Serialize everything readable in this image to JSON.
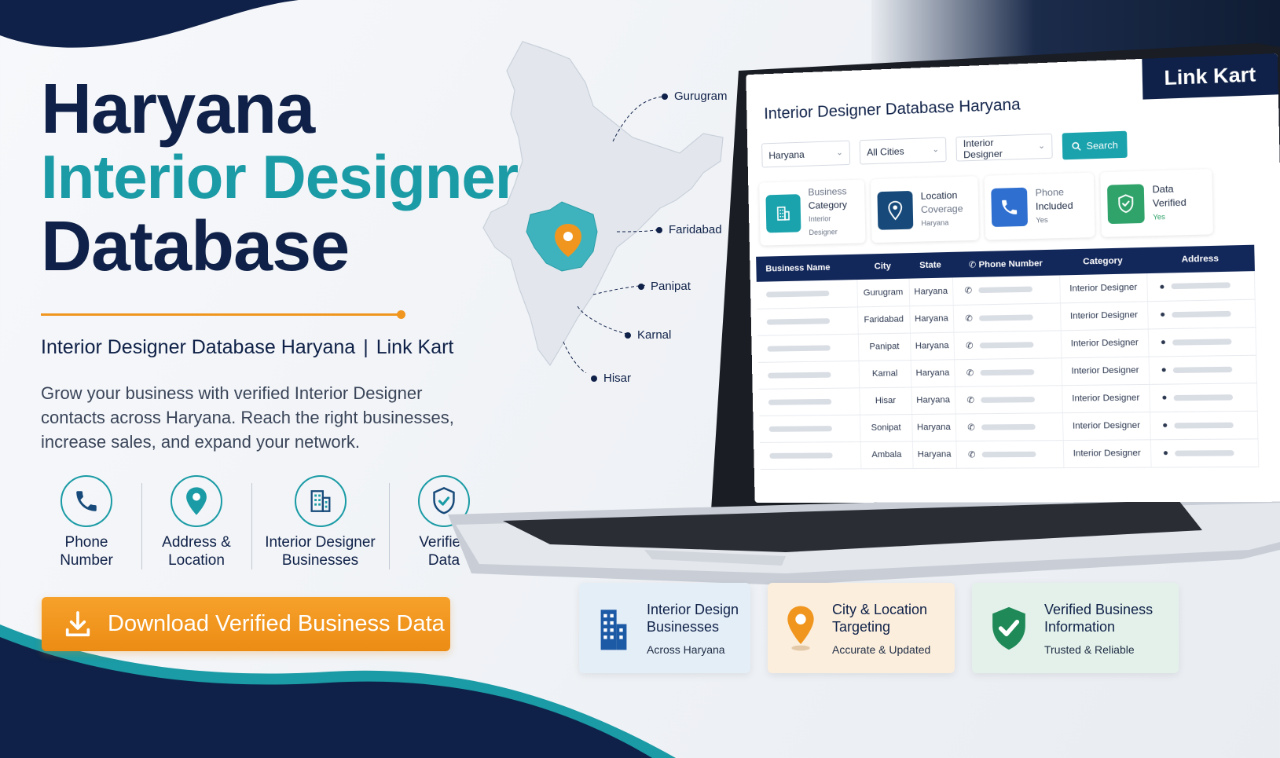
{
  "brand": "Link Kart",
  "hero": {
    "line1": "Haryana",
    "line2": "Interior Designer",
    "line3": "Database",
    "subtitle_left": "Interior Designer Database Haryana",
    "subtitle_sep": "|",
    "subtitle_right": "Link Kart",
    "description": "Grow your business with verified Interior Designer contacts across Haryana. Reach the right businesses, increase sales, and expand your network."
  },
  "features": [
    {
      "icon": "phone-icon",
      "label_1": "Phone",
      "label_2": "Number"
    },
    {
      "icon": "location-pin-icon",
      "label_1": "Address &",
      "label_2": "Location"
    },
    {
      "icon": "building-icon",
      "label_1": "Interior Designer",
      "label_2": "Businesses"
    },
    {
      "icon": "shield-check-icon",
      "label_1": "Verified",
      "label_2": "Data"
    }
  ],
  "download_button": "Download Verified Business Data",
  "map": {
    "cities": [
      "Gurugram",
      "Faridabad",
      "Panipat",
      "Karnal",
      "Hisar"
    ]
  },
  "screen": {
    "brand": "Link Kart",
    "title": "Interior Designer Database Haryana",
    "filters": {
      "state": "Haryana",
      "city": "All Cities",
      "category": "Interior Designer"
    },
    "search_label": "Search",
    "stats": [
      {
        "icon": "building-icon",
        "l1": "Business",
        "l2": "Category",
        "l3": "Interior Designer",
        "color": "#1aa3ad"
      },
      {
        "icon": "location-pin-icon",
        "l1": "Location",
        "l2": "Coverage",
        "l3": "Haryana",
        "color": "#174a7a"
      },
      {
        "icon": "phone-icon",
        "l1": "Phone",
        "l2": "Included",
        "l3": "Yes",
        "color": "#2f6fd0"
      },
      {
        "icon": "shield-check-icon",
        "l1": "Data",
        "l2": "Verified",
        "l3": "Yes",
        "color": "#2fa36a"
      }
    ],
    "table": {
      "headers": [
        "Business Name",
        "City",
        "State",
        "Phone Number",
        "Category",
        "Address"
      ],
      "rows": [
        {
          "city": "Gurugram",
          "state": "Haryana",
          "category": "Interior Designer"
        },
        {
          "city": "Faridabad",
          "state": "Haryana",
          "category": "Interior Designer"
        },
        {
          "city": "Panipat",
          "state": "Haryana",
          "category": "Interior Designer"
        },
        {
          "city": "Karnal",
          "state": "Haryana",
          "category": "Interior Designer"
        },
        {
          "city": "Hisar",
          "state": "Haryana",
          "category": "Interior Designer"
        },
        {
          "city": "Sonipat",
          "state": "Haryana",
          "category": "Interior Designer"
        },
        {
          "city": "Ambala",
          "state": "Haryana",
          "category": "Interior Designer"
        }
      ]
    }
  },
  "bottom_cards": [
    {
      "icon": "building-icon",
      "t1": "Interior Design",
      "t2": "Businesses",
      "t3": "Across Haryana",
      "bg": "#e4eef7"
    },
    {
      "icon": "location-pin-icon",
      "t1": "City & Location",
      "t2": "Targeting",
      "t3": "Accurate & Updated",
      "bg": "#fbeedd"
    },
    {
      "icon": "shield-check-icon",
      "t1": "Verified Business",
      "t2": "Information",
      "t3": "Trusted & Reliable",
      "bg": "#e3f1ea"
    }
  ],
  "colors": {
    "navy": "#0f2148",
    "teal": "#1a9ba5",
    "orange": "#f0961f"
  }
}
